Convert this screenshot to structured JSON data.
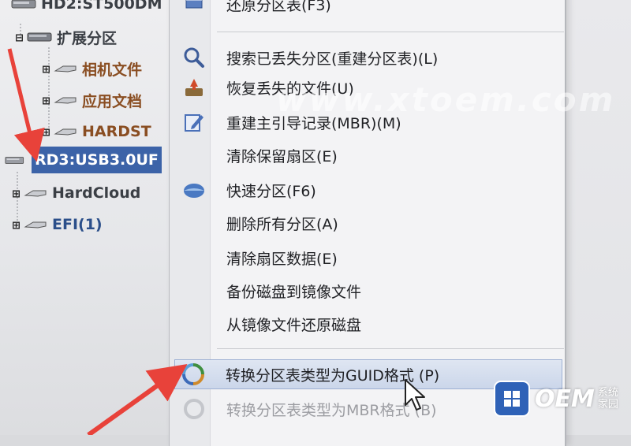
{
  "tree": {
    "items": [
      {
        "label": "HD2:ST500DM"
      },
      {
        "label": "扩展分区"
      },
      {
        "label": "相机文件"
      },
      {
        "label": "应用文档"
      },
      {
        "label": "HARDST"
      },
      {
        "label": "RD3:USB3.0UF"
      },
      {
        "label": "HardCloud"
      },
      {
        "label": "EFI(1)"
      }
    ],
    "expander_symbol": "⊞",
    "collapse_symbol": "⊟"
  },
  "menu": {
    "items": [
      {
        "label": "还原分区表(F3)",
        "icon": "restore-table-icon"
      },
      {
        "label": "搜索已丢失分区(重建分区表)(L)",
        "icon": "search-icon"
      },
      {
        "label": "恢复丢失的文件(U)",
        "icon": "recover-files-icon"
      },
      {
        "label": "重建主引导记录(MBR)(M)",
        "icon": "edit-mbr-icon"
      },
      {
        "label": "清除保留扇区(E)",
        "icon": ""
      },
      {
        "label": "快速分区(F6)",
        "icon": "quick-partition-icon"
      },
      {
        "label": "删除所有分区(A)",
        "icon": ""
      },
      {
        "label": "清除扇区数据(E)",
        "icon": ""
      },
      {
        "label": "备份磁盘到镜像文件",
        "icon": ""
      },
      {
        "label": "从镜像文件还原磁盘",
        "icon": ""
      },
      {
        "label": "转换分区表类型为GUID格式 (P)",
        "icon": "convert-icon"
      },
      {
        "label": "转换分区表类型为MBR格式 (B)",
        "icon": "convert-disabled-icon"
      }
    ]
  },
  "watermark": "www.xtoem.com",
  "logo": {
    "main": "OEM",
    "sub_line1": "系统",
    "sub_line2": "家园"
  },
  "colors": {
    "selection": "#3c63a8",
    "arrow": "#e8423a",
    "highlight": "#cbd6ea",
    "logo": "#2f62b7"
  }
}
